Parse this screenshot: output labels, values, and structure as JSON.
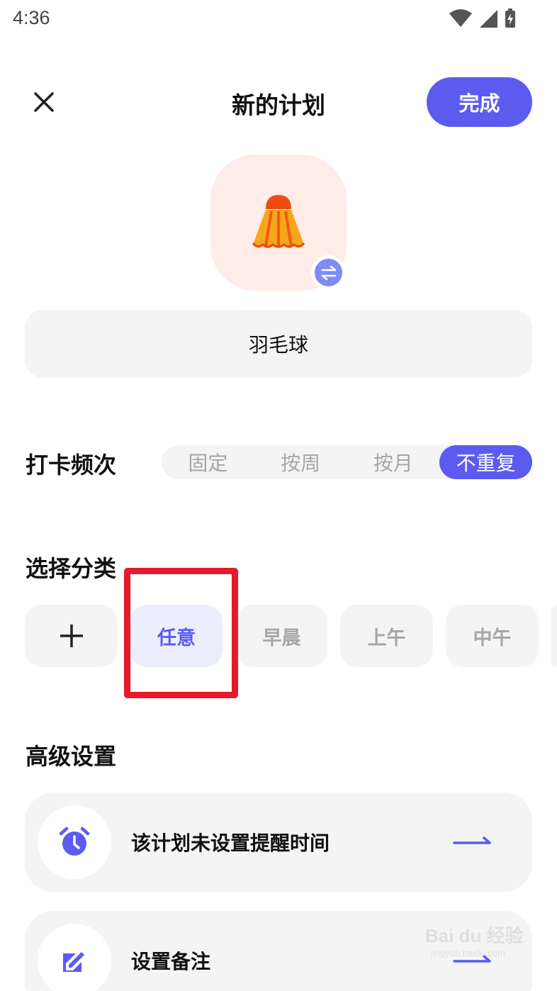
{
  "status_bar": {
    "time": "4:36"
  },
  "header": {
    "title": "新的计划",
    "done_label": "完成"
  },
  "plan": {
    "icon": "badminton-shuttlecock-icon",
    "name": "羽毛球"
  },
  "frequency": {
    "label": "打卡频次",
    "options": [
      "固定",
      "按周",
      "按月",
      "不重复"
    ],
    "selected": "不重复"
  },
  "category": {
    "label": "选择分类",
    "add_icon": "plus-icon",
    "chips": [
      "任意",
      "早晨",
      "上午",
      "中午"
    ],
    "selected": "任意"
  },
  "advanced": {
    "label": "高级设置",
    "items": [
      {
        "icon": "alarm-clock-icon",
        "text": "该计划未设置提醒时间"
      },
      {
        "icon": "edit-note-icon",
        "text": "设置备注"
      }
    ]
  },
  "watermark": {
    "main": "Bai du 经验",
    "sub": "jingyan.baidu.com"
  },
  "colors": {
    "accent": "#5b5bf0",
    "highlight": "#e8192c",
    "chip_bg": "#f4f4f4",
    "icon_bg": "#fdece7"
  }
}
